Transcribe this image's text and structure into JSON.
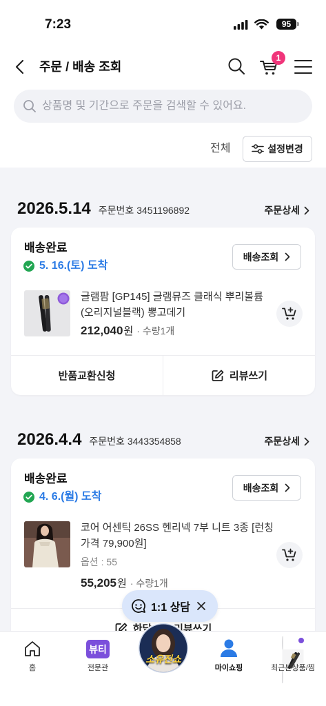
{
  "status_bar": {
    "time": "7:23",
    "battery": "95"
  },
  "header": {
    "title": "주문 / 배송 조회",
    "cart_badge": "1"
  },
  "search": {
    "placeholder": "상품명 및 기간으로 주문을 검색할 수 있어요."
  },
  "filter": {
    "current": "전체",
    "settings_label": "설정변경"
  },
  "orders": [
    {
      "date": "2026.5.14",
      "order_number": "주문번호 3451196892",
      "detail_label": "주문상세",
      "status": "배송완료",
      "arrival": "5. 16.(토) 도착",
      "track_label": "배송조회",
      "product": {
        "name": "글램팜 [GP145] 글램뮤즈 클래식 뿌리볼륨 (오리지널블랙) 뽕고데기",
        "price": "212,040",
        "currency": "원",
        "quantity": "· 수량1개"
      },
      "actions": {
        "left": "반품교환신청",
        "right": "리뷰쓰기"
      }
    },
    {
      "date": "2026.4.4",
      "order_number": "주문번호 3443354858",
      "detail_label": "주문상세",
      "status": "배송완료",
      "arrival": "4. 6.(월) 도착",
      "track_label": "배송조회",
      "product": {
        "name": "코어 어센틱 26SS 헨리넥 7부 니트 3종 [런칭 가격 79,900원]",
        "option": "옵션 : 55",
        "price": "55,205",
        "currency": "원",
        "quantity": "· 수량1개"
      },
      "actions": {
        "center": "한달사용 리뷰쓰기"
      }
    }
  ],
  "floating_chat": {
    "label": "1:1 상담"
  },
  "tab_bar": {
    "home": {
      "label": "홈",
      "icon": "home-icon"
    },
    "beauty": {
      "badge": "뷰티",
      "label": "전문관",
      "icon": "beauty-badge"
    },
    "live": {
      "overlay": "소유진쇼",
      "icon": "live-show-thumbnail"
    },
    "my": {
      "label": "마이쇼핑",
      "icon": "person-icon",
      "active": true
    },
    "recent": {
      "label": "최근본상품/찜",
      "icon": "recent-item-thumbnail"
    }
  },
  "colors": {
    "accent": "#2b7be5",
    "badge": "#f0357a",
    "success": "#22a652",
    "beauty": "#7b4fdb",
    "chip": "#dae6fb",
    "section_bg": "#f3f4f8"
  }
}
